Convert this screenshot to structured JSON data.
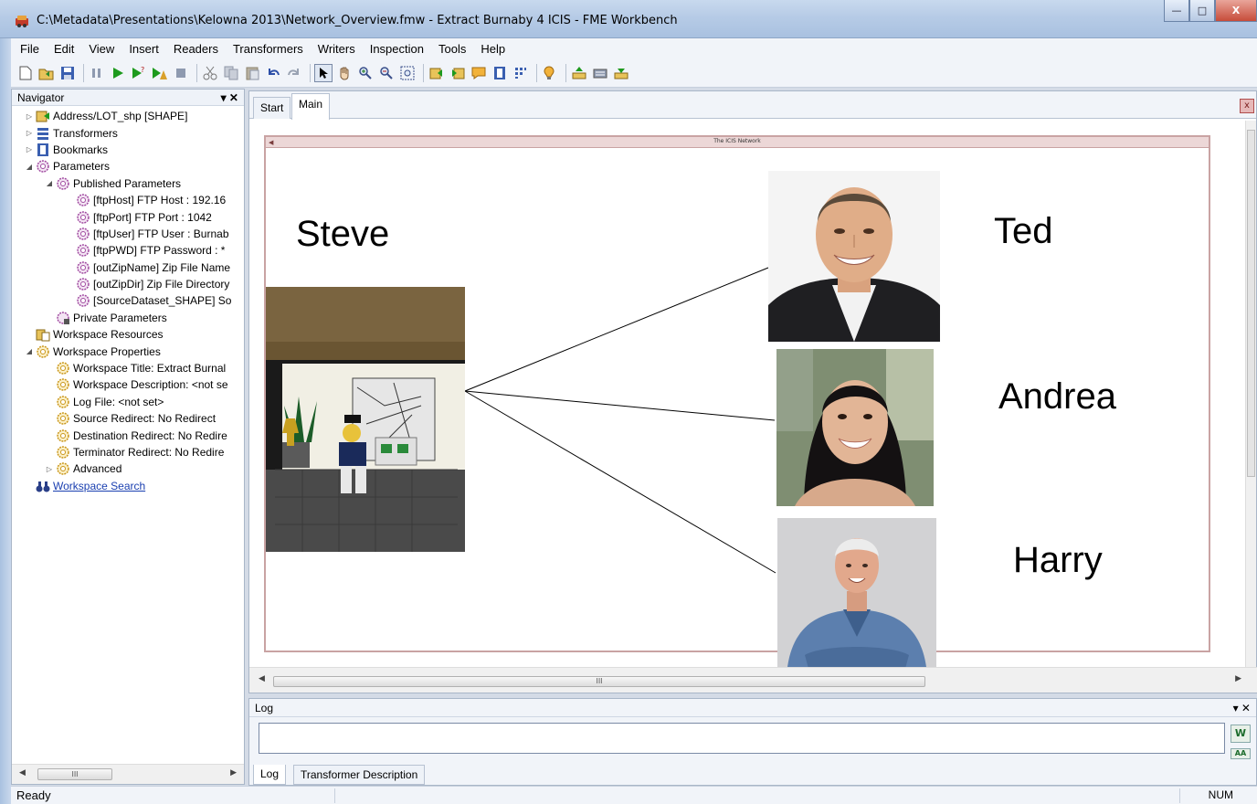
{
  "window": {
    "title": "C:\\Metadata\\Presentations\\Kelowna 2013\\Network_Overview.fmw - Extract Burnaby 4 ICIS - FME Workbench",
    "btn_minimize": "—",
    "btn_maximize": "□",
    "btn_close": "X"
  },
  "menu": [
    "File",
    "Edit",
    "View",
    "Insert",
    "Readers",
    "Transformers",
    "Writers",
    "Inspection",
    "Tools",
    "Help"
  ],
  "navigator": {
    "title": "Navigator",
    "pin": "▾ ✕",
    "items": [
      {
        "text": "Address/LOT_shp [SHAPE]",
        "indent": 0,
        "twisty": "▷",
        "icon": "reader-icon"
      },
      {
        "text": "Transformers",
        "indent": 0,
        "twisty": "▷",
        "icon": "transformers-icon"
      },
      {
        "text": "Bookmarks",
        "indent": 0,
        "twisty": "▷",
        "icon": "bookmarks-icon"
      },
      {
        "text": "Parameters",
        "indent": 0,
        "twisty": "◢",
        "icon": "gear-icon"
      },
      {
        "text": "Published Parameters",
        "indent": 1,
        "twisty": "◢",
        "icon": "gear-icon"
      },
      {
        "text": "[ftpHost] FTP Host : 192.16",
        "indent": 2,
        "twisty": "",
        "icon": "gear-icon"
      },
      {
        "text": "[ftpPort] FTP Port : 1042",
        "indent": 2,
        "twisty": "",
        "icon": "gear-icon"
      },
      {
        "text": "[ftpUser] FTP User : Burnab",
        "indent": 2,
        "twisty": "",
        "icon": "gear-icon"
      },
      {
        "text": "[ftpPWD] FTP Password : *",
        "indent": 2,
        "twisty": "",
        "icon": "gear-icon"
      },
      {
        "text": "[outZipName] Zip File Name",
        "indent": 2,
        "twisty": "",
        "icon": "gear-icon"
      },
      {
        "text": "[outZipDir] Zip File Directory",
        "indent": 2,
        "twisty": "",
        "icon": "gear-icon"
      },
      {
        "text": "[SourceDataset_SHAPE] So",
        "indent": 2,
        "twisty": "",
        "icon": "gear-icon"
      },
      {
        "text": "Private Parameters",
        "indent": 1,
        "twisty": "",
        "icon": "private-gear-icon"
      },
      {
        "text": "Workspace Resources",
        "indent": 0,
        "twisty": "",
        "icon": "resources-icon"
      },
      {
        "text": "Workspace Properties",
        "indent": 0,
        "twisty": "◢",
        "icon": "gold-gear-icon"
      },
      {
        "text": "Workspace Title: Extract Burnal",
        "indent": 1,
        "twisty": "",
        "icon": "gold-gear-icon"
      },
      {
        "text": "Workspace Description: <not se",
        "indent": 1,
        "twisty": "",
        "icon": "gold-gear-icon"
      },
      {
        "text": "Log File: <not set>",
        "indent": 1,
        "twisty": "",
        "icon": "gold-gear-icon"
      },
      {
        "text": "Source Redirect: No Redirect",
        "indent": 1,
        "twisty": "",
        "icon": "gold-gear-icon"
      },
      {
        "text": "Destination Redirect: No Redire",
        "indent": 1,
        "twisty": "",
        "icon": "gold-gear-icon"
      },
      {
        "text": "Terminator Redirect: No Redire",
        "indent": 1,
        "twisty": "",
        "icon": "gold-gear-icon"
      },
      {
        "text": "Advanced",
        "indent": 1,
        "twisty": "▷",
        "icon": "gold-gear-icon"
      },
      {
        "text": "Workspace Search",
        "indent": 0,
        "twisty": "",
        "icon": "binoculars-icon",
        "link": true
      }
    ]
  },
  "canvas": {
    "tabs": [
      {
        "label": "Start",
        "active": false
      },
      {
        "label": "Main",
        "active": true
      }
    ],
    "close": "x",
    "bookmark_title": "The ICIS Network",
    "scroll_grip": "III"
  },
  "people": {
    "steve": "Steve",
    "ted": "Ted",
    "andrea": "Andrea",
    "harry": "Harry"
  },
  "log": {
    "title": "Log",
    "pin": "▾ ✕",
    "tabs": [
      {
        "label": "Log",
        "active": true
      },
      {
        "label": "Transformer Description",
        "active": false
      }
    ]
  },
  "status": {
    "text": "Ready",
    "num": "NUM"
  },
  "colors": {
    "bookmark_border": "#c9a3a3",
    "bookmark_bar": "#ecd7d7",
    "link": "#1a3fb0"
  }
}
